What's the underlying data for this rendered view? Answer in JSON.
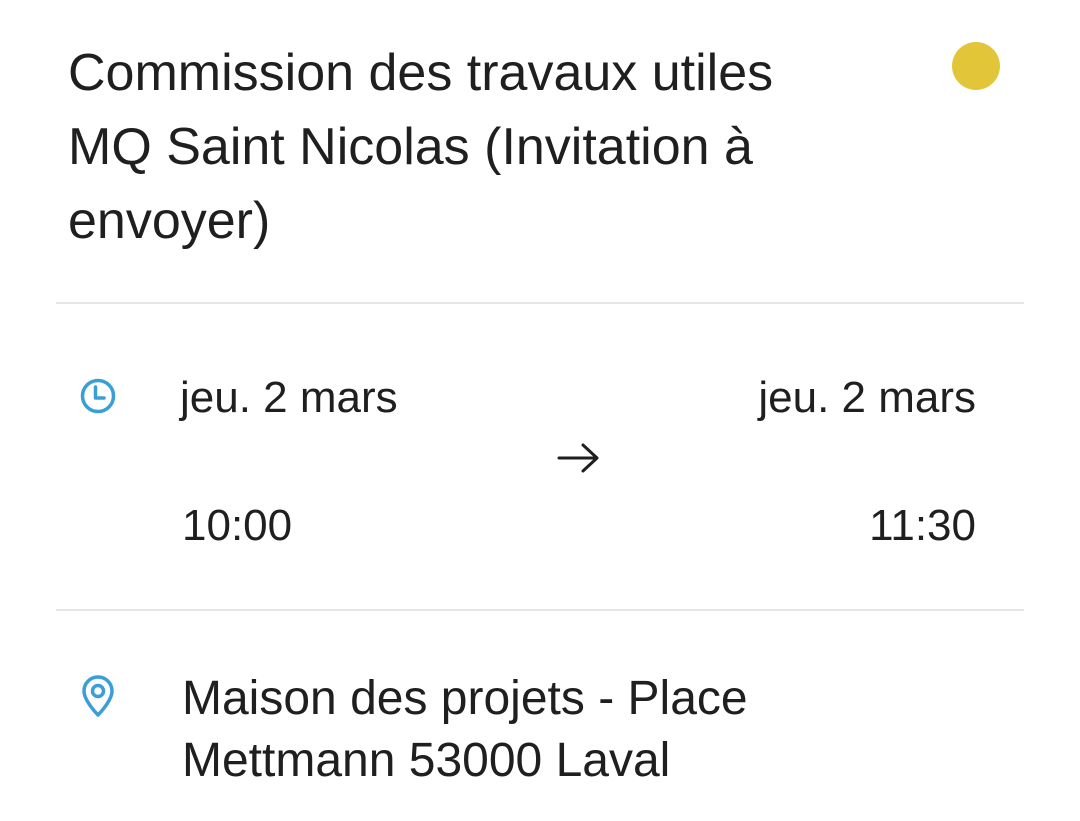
{
  "event": {
    "title": "Commission des travaux utiles MQ Saint Nicolas (Invitation à envoyer)",
    "color": "#e3c53a"
  },
  "datetime": {
    "icon": "clock-icon",
    "start_date": "jeu. 2 mars",
    "start_time": "10:00",
    "end_date": "jeu. 2 mars",
    "end_time": "11:30",
    "arrow_icon": "arrow-right-icon"
  },
  "location": {
    "icon": "location-pin-icon",
    "text": "Maison des projets - Place Mettmann 53000 Laval"
  },
  "colors": {
    "accent": "#3a9fd6",
    "divider": "#e6e6e6",
    "text": "#1f1f1f"
  }
}
